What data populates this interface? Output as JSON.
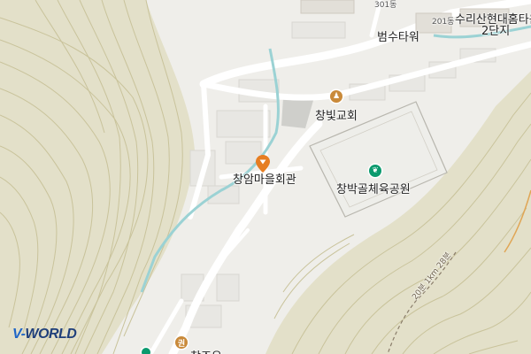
{
  "map": {
    "labels": {
      "beomsu_tower": "범수타워",
      "suri_hyundai": "수리산현대홈타운",
      "danji2": "2단지",
      "bldg_301": "301동",
      "bldg_201": "201동",
      "changbit_church": "창빛교회",
      "changam_hall": "창암마을회관",
      "changbakgol_park": "창박골체육공원",
      "road_label": "20분 1km 28분",
      "bottom_partial": "창조유"
    },
    "icons": {
      "church": "person-walking-icon",
      "park": "leaf-icon",
      "pin": "location-pin-icon",
      "bottom_poi": "clinic-icon",
      "bottom_green": "green-poi-icon"
    },
    "colors": {
      "park": "#0b9a6e",
      "church": "#c98a3a",
      "pin": "#e67e22",
      "stream": "#9bd2d4",
      "contour": "#c8c39e"
    },
    "logo": {
      "part1": "V-",
      "part2": "WORLD"
    },
    "glyphs": {
      "church": "♟",
      "park": "❦",
      "clinic": "권"
    }
  }
}
